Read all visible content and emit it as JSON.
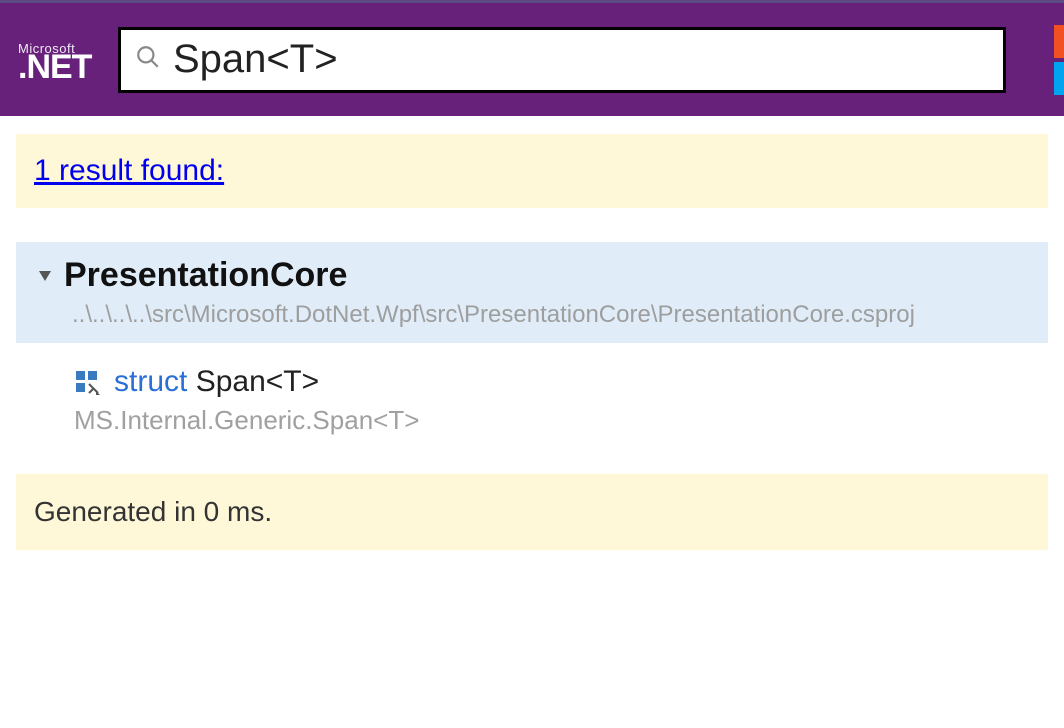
{
  "header": {
    "logo_top": "Microsoft",
    "logo_bottom": ".NET",
    "search_value": "Span<T>"
  },
  "summary": {
    "link_text": "1 result found:"
  },
  "project": {
    "name": "PresentationCore",
    "path": "..\\..\\..\\..\\src\\Microsoft.DotNet.Wpf\\src\\PresentationCore\\PresentationCore.csproj"
  },
  "result": {
    "keyword": "struct",
    "name": "Span<T>",
    "namespace": "MS.Internal.Generic.Span<T>"
  },
  "footer": {
    "generated": "Generated in 0 ms."
  }
}
